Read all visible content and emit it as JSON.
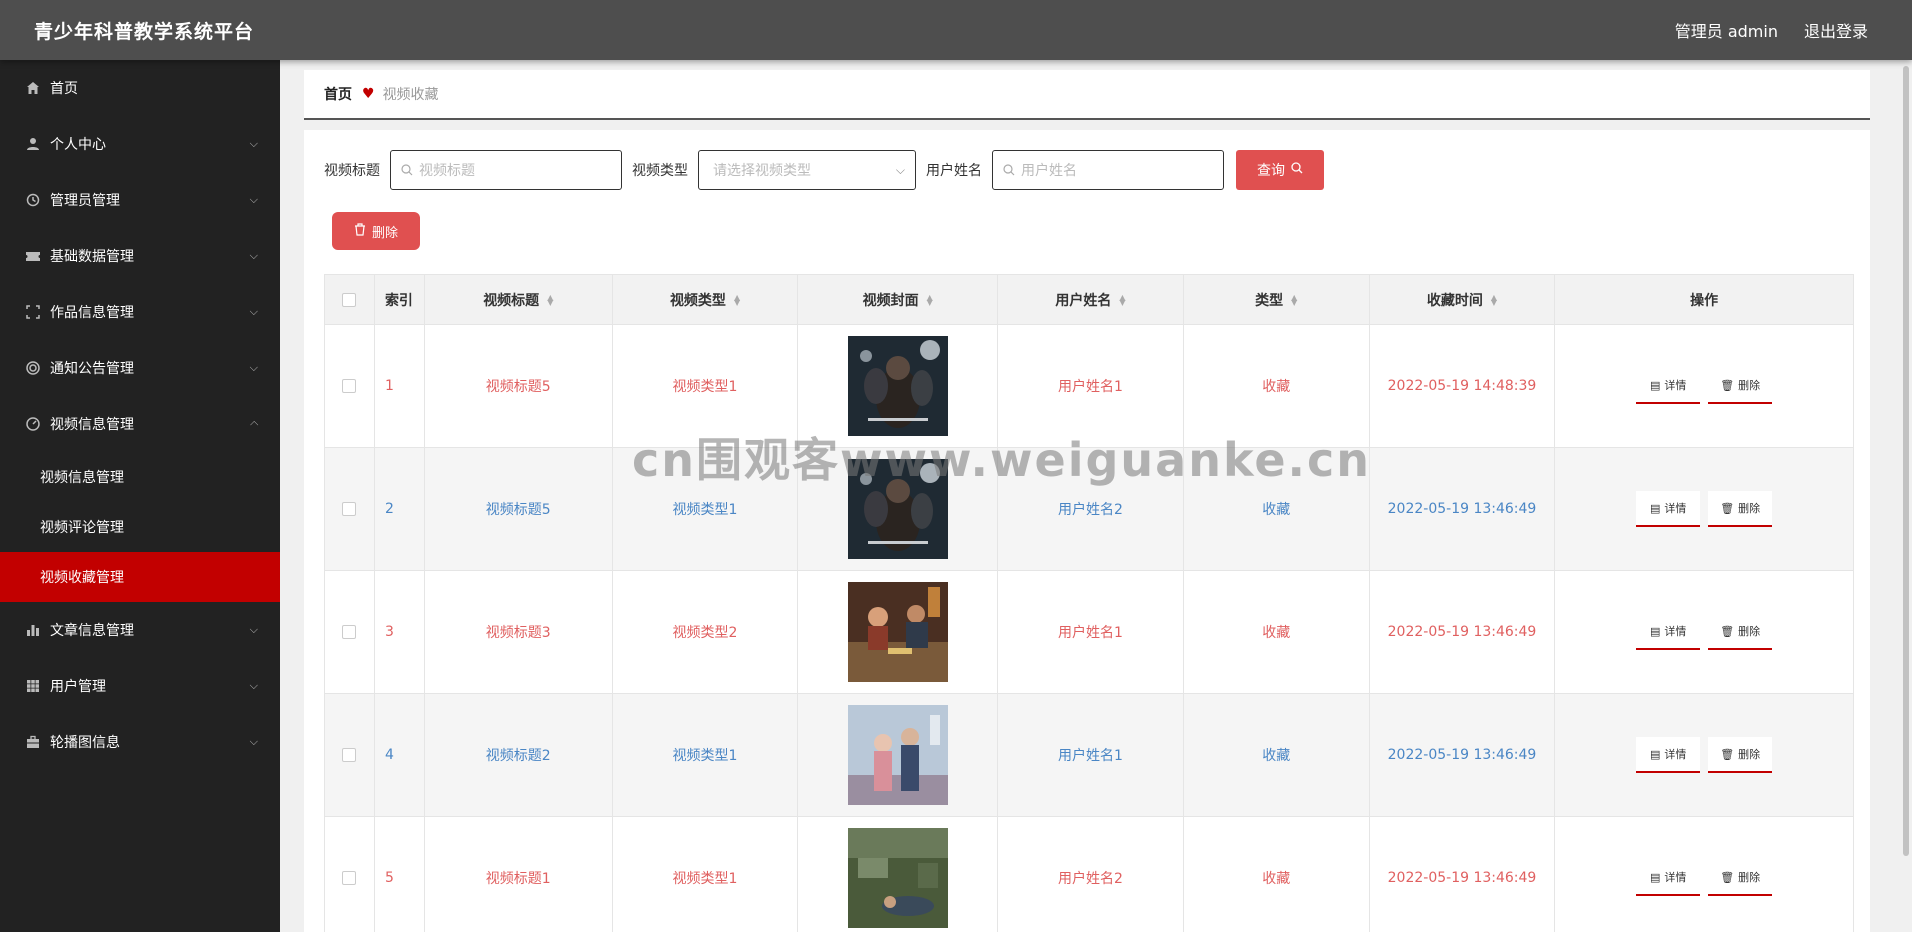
{
  "app": {
    "title": "青少年科普教学系统平台",
    "user_label": "管理员 admin",
    "logout_label": "退出登录"
  },
  "sidebar": {
    "items": [
      {
        "label": "首页",
        "icon": "home-icon",
        "expandable": false
      },
      {
        "label": "个人中心",
        "icon": "user-icon",
        "expandable": true
      },
      {
        "label": "管理员管理",
        "icon": "clock-icon",
        "expandable": true
      },
      {
        "label": "基础数据管理",
        "icon": "ticket-icon",
        "expandable": true
      },
      {
        "label": "作品信息管理",
        "icon": "frame-icon",
        "expandable": true
      },
      {
        "label": "通知公告管理",
        "icon": "bell-circle-icon",
        "expandable": true
      },
      {
        "label": "视频信息管理",
        "icon": "gauge-icon",
        "expandable": true,
        "expanded": true
      }
    ],
    "sub_items": [
      {
        "label": "视频信息管理",
        "active": false
      },
      {
        "label": "视频评论管理",
        "active": false
      },
      {
        "label": "视频收藏管理",
        "active": true
      }
    ],
    "items_after": [
      {
        "label": "文章信息管理",
        "icon": "bar-chart-icon",
        "expandable": true
      },
      {
        "label": "用户管理",
        "icon": "grid-icon",
        "expandable": true
      },
      {
        "label": "轮播图信息",
        "icon": "briefcase-icon",
        "expandable": true
      }
    ]
  },
  "breadcrumb": {
    "home": "首页",
    "current": "视频收藏"
  },
  "filters": {
    "title_label": "视频标题",
    "title_placeholder": "视频标题",
    "type_label": "视频类型",
    "type_placeholder": "请选择视频类型",
    "user_label": "用户姓名",
    "user_placeholder": "用户姓名",
    "query_label": "查询"
  },
  "actions": {
    "delete_label": "删除"
  },
  "table": {
    "headers": {
      "index": "索引",
      "title": "视频标题",
      "type": "视频类型",
      "cover": "视频封面",
      "user": "用户姓名",
      "kind": "类型",
      "time": "收藏时间",
      "op": "操作"
    },
    "rows": [
      {
        "index": "1",
        "title": "视频标题5",
        "type": "视频类型1",
        "user": "用户姓名1",
        "kind": "收藏",
        "time": "2022-05-19 14:48:39",
        "cover": "dune"
      },
      {
        "index": "2",
        "title": "视频标题5",
        "type": "视频类型1",
        "user": "用户姓名2",
        "kind": "收藏",
        "time": "2022-05-19 13:46:49",
        "cover": "dune"
      },
      {
        "index": "3",
        "title": "视频标题3",
        "type": "视频类型2",
        "user": "用户姓名1",
        "kind": "收藏",
        "time": "2022-05-19 13:46:49",
        "cover": "dinner"
      },
      {
        "index": "4",
        "title": "视频标题2",
        "type": "视频类型1",
        "user": "用户姓名1",
        "kind": "收藏",
        "time": "2022-05-19 13:46:49",
        "cover": "couple"
      },
      {
        "index": "5",
        "title": "视频标题1",
        "type": "视频类型1",
        "user": "用户姓名2",
        "kind": "收藏",
        "time": "2022-05-19 13:46:49",
        "cover": "garden"
      }
    ],
    "detail_label": "详情",
    "delete_label": "删除"
  },
  "watermark": "cn围观客www.weiguanke.cn"
}
